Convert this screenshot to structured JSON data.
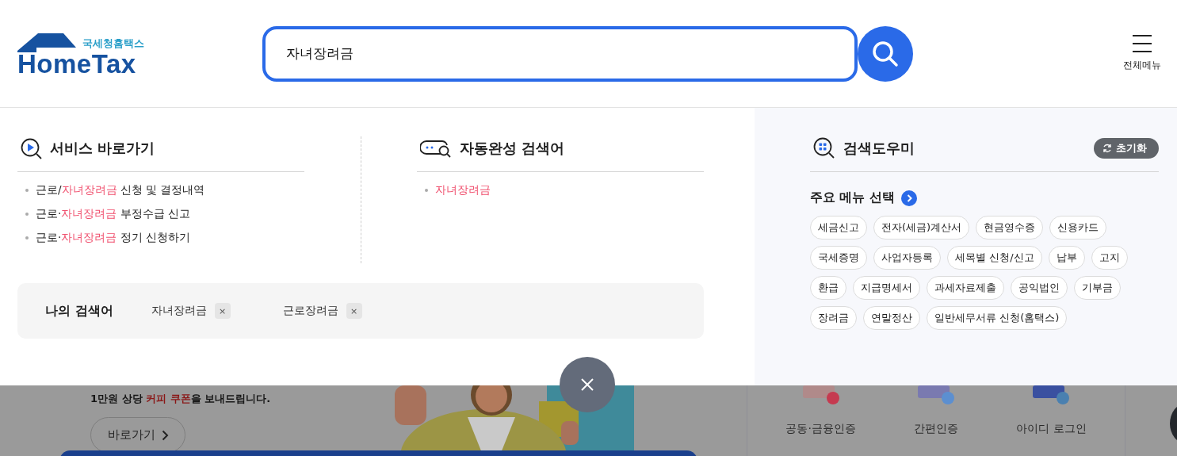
{
  "logo": {
    "subtitle": "국세청홈택스",
    "title": "HomeTax"
  },
  "search": {
    "value": "자녀장려금"
  },
  "menu_button": {
    "label": "전체메뉴"
  },
  "services": {
    "title": "서비스 바로가기",
    "items": [
      {
        "parts": [
          {
            "text": "근로/",
            "highlight": false
          },
          {
            "text": "자녀장려금",
            "highlight": true
          },
          {
            "text": " 신청 및 결정내역",
            "highlight": false
          }
        ]
      },
      {
        "parts": [
          {
            "text": "근로·",
            "highlight": false
          },
          {
            "text": "자녀장려금",
            "highlight": true
          },
          {
            "text": " 부정수급 신고",
            "highlight": false
          }
        ]
      },
      {
        "parts": [
          {
            "text": "근로·",
            "highlight": false
          },
          {
            "text": "자녀장려금",
            "highlight": true
          },
          {
            "text": " 정기 신청하기",
            "highlight": false
          }
        ]
      }
    ]
  },
  "autocomplete": {
    "title": "자동완성 검색어",
    "items": [
      {
        "parts": [
          {
            "text": "자녀장려금",
            "highlight": true
          }
        ]
      }
    ]
  },
  "my_searches": {
    "title": "나의 검색어",
    "items": [
      {
        "text": "자녀장려금",
        "remove": "×"
      },
      {
        "text": "근로장려금",
        "remove": "×"
      }
    ]
  },
  "helper": {
    "title": "검색도우미",
    "reset": "초기화",
    "menu_title": "주요 메뉴 선택",
    "tags": [
      "세금신고",
      "전자(세금)계산서",
      "현금영수증",
      "신용카드",
      "국세증명",
      "사업자등록",
      "세목별 신청/신고",
      "납부",
      "고지",
      "환급",
      "지급명세서",
      "과세자료제출",
      "공익법인",
      "기부금",
      "장려금",
      "연말정산",
      "일반세무서류 신청(홈택스)"
    ]
  },
  "background_page": {
    "promo_text": [
      {
        "text": "1만원 상당 ",
        "highlight": false
      },
      {
        "text": "커피 쿠폰",
        "highlight": true
      },
      {
        "text": "을 보내드립니다.",
        "highlight": false
      }
    ],
    "promo_button": "바로가기",
    "login_options": [
      "공동·금융인증",
      "간편인증",
      "아이디 로그인"
    ]
  }
}
